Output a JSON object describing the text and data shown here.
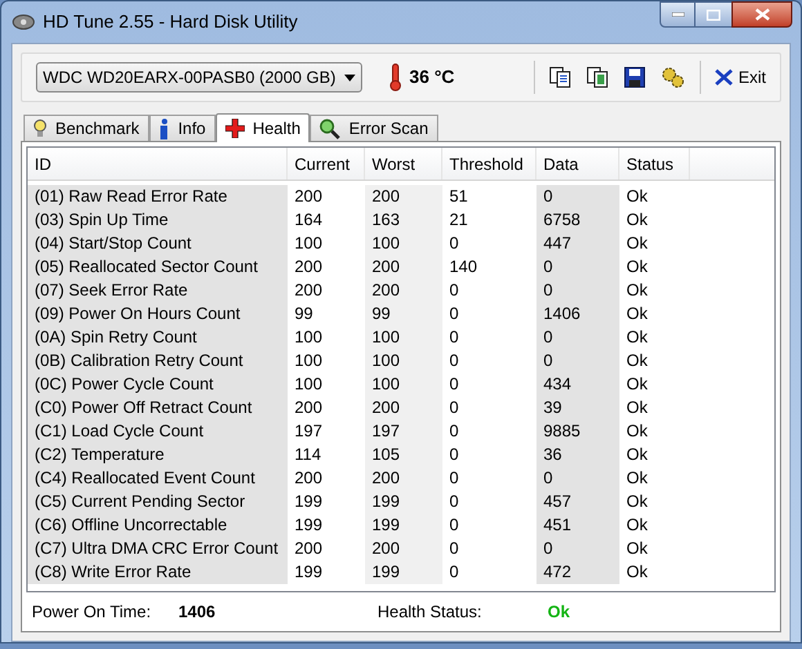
{
  "window": {
    "title": "HD Tune 2.55 - Hard Disk Utility"
  },
  "drive_select": {
    "value": "WDC WD20EARX-00PASB0 (2000 GB)"
  },
  "temperature": "36 °C",
  "exit_button": "Exit",
  "tabs": [
    {
      "label": "Benchmark",
      "selected": false,
      "kind": "bulb"
    },
    {
      "label": "Info",
      "selected": false,
      "kind": "info"
    },
    {
      "label": "Health",
      "selected": true,
      "kind": "cross"
    },
    {
      "label": "Error Scan",
      "selected": false,
      "kind": "magnifier"
    }
  ],
  "table": {
    "columns": [
      "ID",
      "Current",
      "Worst",
      "Threshold",
      "Data",
      "Status"
    ],
    "rows": [
      [
        "(01) Raw Read Error Rate",
        "200",
        "200",
        "51",
        "0",
        "Ok"
      ],
      [
        "(03) Spin Up Time",
        "164",
        "163",
        "21",
        "6758",
        "Ok"
      ],
      [
        "(04) Start/Stop Count",
        "100",
        "100",
        "0",
        "447",
        "Ok"
      ],
      [
        "(05) Reallocated Sector Count",
        "200",
        "200",
        "140",
        "0",
        "Ok"
      ],
      [
        "(07) Seek Error Rate",
        "200",
        "200",
        "0",
        "0",
        "Ok"
      ],
      [
        "(09) Power On Hours Count",
        "99",
        "99",
        "0",
        "1406",
        "Ok"
      ],
      [
        "(0A) Spin Retry Count",
        "100",
        "100",
        "0",
        "0",
        "Ok"
      ],
      [
        "(0B) Calibration Retry Count",
        "100",
        "100",
        "0",
        "0",
        "Ok"
      ],
      [
        "(0C) Power Cycle Count",
        "100",
        "100",
        "0",
        "434",
        "Ok"
      ],
      [
        "(C0) Power Off Retract Count",
        "200",
        "200",
        "0",
        "39",
        "Ok"
      ],
      [
        "(C1) Load Cycle Count",
        "197",
        "197",
        "0",
        "9885",
        "Ok"
      ],
      [
        "(C2) Temperature",
        "114",
        "105",
        "0",
        "36",
        "Ok"
      ],
      [
        "(C4) Reallocated Event Count",
        "200",
        "200",
        "0",
        "0",
        "Ok"
      ],
      [
        "(C5) Current Pending Sector",
        "199",
        "199",
        "0",
        "457",
        "Ok"
      ],
      [
        "(C6) Offline Uncorrectable",
        "199",
        "199",
        "0",
        "451",
        "Ok"
      ],
      [
        "(C7) Ultra DMA CRC Error Count",
        "200",
        "200",
        "0",
        "0",
        "Ok"
      ],
      [
        "(C8) Write Error Rate",
        "199",
        "199",
        "0",
        "472",
        "Ok"
      ]
    ]
  },
  "status": {
    "power_on_label": "Power On Time:",
    "power_on_value": "1406",
    "health_label": "Health Status:",
    "health_value": "Ok"
  }
}
